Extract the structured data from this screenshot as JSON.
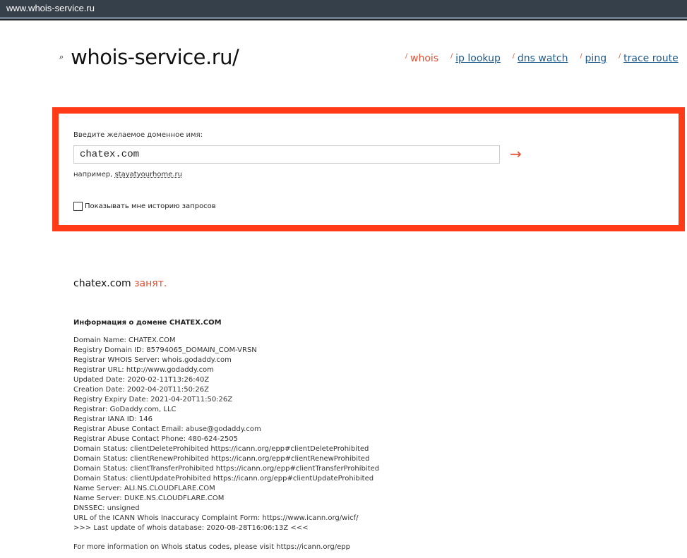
{
  "browser": {
    "address": "www.whois-service.ru"
  },
  "header": {
    "logo": "whois-service.ru/",
    "nav": [
      {
        "label": "whois",
        "active": true
      },
      {
        "label": "ip lookup"
      },
      {
        "label": "dns watch"
      },
      {
        "label": "ping"
      },
      {
        "label": "trace route"
      }
    ]
  },
  "form": {
    "label": "Введите желаемое доменное имя:",
    "value": "chatex.com",
    "submit_icon": "arrow-right",
    "example_prefix": "например,",
    "example_link": "stayatyourhome.ru",
    "history_checkbox": "Показывать мне историю запросов",
    "history_checked": false
  },
  "result": {
    "domain": "chatex.com",
    "status": "занят.",
    "info_title": "Информация о домене CHATEX.COM",
    "lines": [
      "Domain Name: CHATEX.COM",
      "Registry Domain ID: 85794065_DOMAIN_COM-VRSN",
      "Registrar WHOIS Server: whois.godaddy.com",
      "Registrar URL: http://www.godaddy.com",
      "Updated Date: 2020-02-11T13:26:40Z",
      "Creation Date: 2002-04-20T11:50:26Z",
      "Registry Expiry Date: 2021-04-20T11:50:26Z",
      "Registrar: GoDaddy.com, LLC",
      "Registrar IANA ID: 146",
      "Registrar Abuse Contact Email: abuse@godaddy.com",
      "Registrar Abuse Contact Phone: 480-624-2505",
      "Domain Status: clientDeleteProhibited https://icann.org/epp#clientDeleteProhibited",
      "Domain Status: clientRenewProhibited https://icann.org/epp#clientRenewProhibited",
      "Domain Status: clientTransferProhibited https://icann.org/epp#clientTransferProhibited",
      "Domain Status: clientUpdateProhibited https://icann.org/epp#clientUpdateProhibited",
      "Name Server: ALI.NS.CLOUDFLARE.COM",
      "Name Server: DUKE.NS.CLOUDFLARE.COM",
      "DNSSEC: unsigned",
      "URL of the ICANN Whois Inaccuracy Complaint Form: https://www.icann.org/wicf/",
      ">>> Last update of whois database: 2020-08-28T16:06:13Z <<<"
    ],
    "footer": "For more information on Whois status codes, please visit https://icann.org/epp"
  }
}
